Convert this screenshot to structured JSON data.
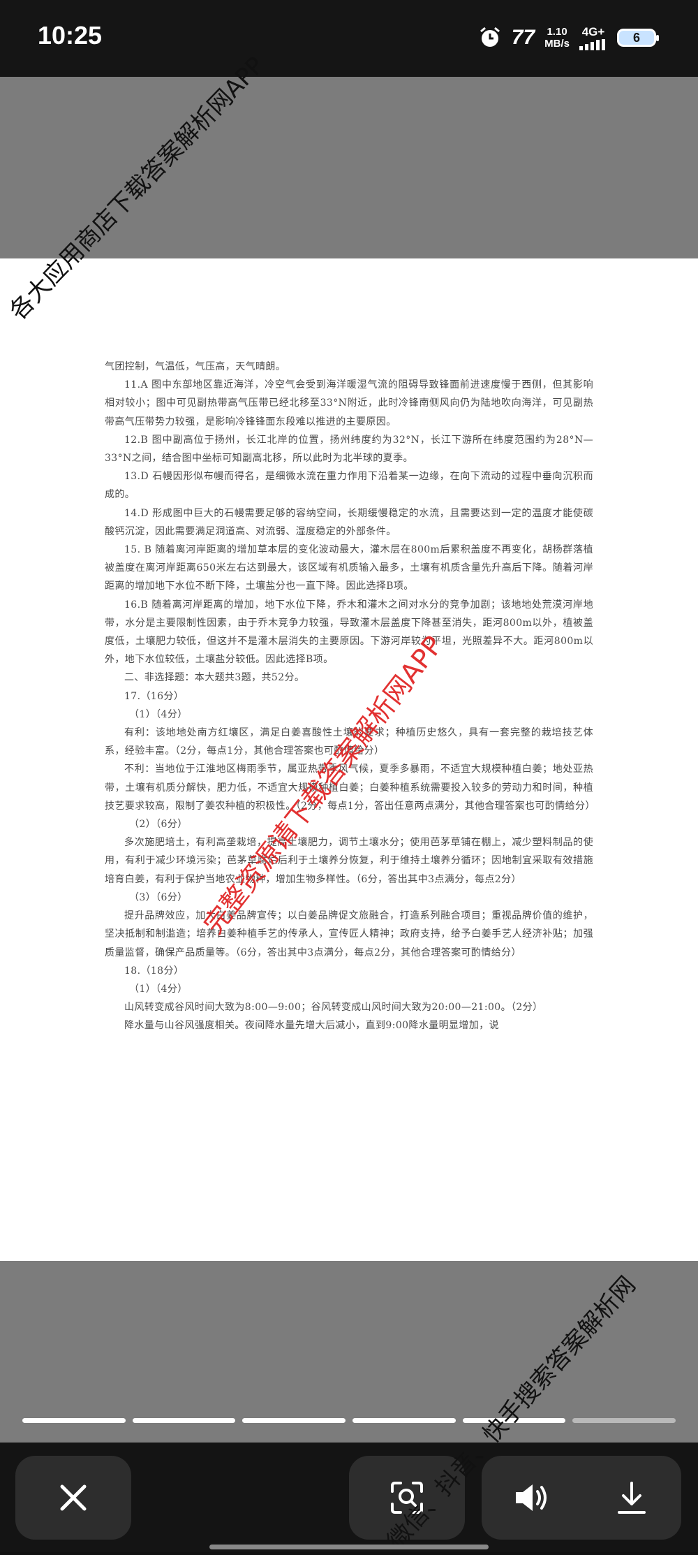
{
  "status_bar": {
    "time": "10:25",
    "carrier_logo": "77",
    "speed_value": "1.10",
    "speed_unit": "MB/s",
    "network_type": "4G+",
    "battery_level": "6"
  },
  "document": {
    "lines": [
      "气团控制，气温低，气压高，天气晴朗。",
      "11.A 图中东部地区靠近海洋，冷空气会受到海洋暖湿气流的阻碍导致锋面前进速度慢于西侧，但其影响相对较小；图中可见副热带高气压带已经北移至33°N附近，此时冷锋南侧风向仍为陆地吹向海洋，可见副热带高气压带势力较强，是影响冷锋锋面东段难以推进的主要原因。",
      "12.B 图中副高位于扬州，长江北岸的位置，扬州纬度约为32°N，长江下游所在纬度范围约为28°N—33°N之间，结合图中坐标可知副高北移，所以此时为北半球的夏季。",
      "13.D 石幔因形似布幔而得名，是细微水流在重力作用下沿着某一边缘，在向下流动的过程中垂向沉积而成的。",
      "14.D 形成图中巨大的石幔需要足够的容纳空间，长期缓慢稳定的水流，且需要达到一定的温度才能使碳酸钙沉淀，因此需要满足洞道高、对流弱、湿度稳定的外部条件。",
      "15. B 随着离河岸距离的增加草本层的变化波动最大，灌木层在800m后累积盖度不再变化，胡杨群落植被盖度在离河岸距离650米左右达到最大，该区域有机质输入最多，土壤有机质含量先升高后下降。随着河岸距离的增加地下水位不断下降，土壤盐分也一直下降。因此选择B项。",
      "16.B 随着离河岸距离的增加，地下水位下降，乔木和灌木之间对水分的竞争加剧；该地地处荒漠河岸地带，水分是主要限制性因素，由于乔木竞争力较强，导致灌木层盖度下降甚至消失，距河800m以外，植被盖度低，土壤肥力较低，但这并不是灌木层消失的主要原因。下游河岸较为平坦，光照差异不大。距河800m以外，地下水位较低，土壤盐分较低。因此选择B项。",
      "二、非选择题：本大题共3题，共52分。",
      "17.（16分）",
      "（1）（4分）",
      "有利：该地地处南方红壤区，满足白姜喜酸性土壤的要求；种植历史悠久，具有一套完整的栽培技艺体系，经验丰富。（2分，每点1分，其他合理答案也可酌情给分）",
      "不利：当地位于江淮地区梅雨季节，属亚热带季风气候，夏季多暴雨，不适宜大规模种植白姜；地处亚热带，土壤有机质分解快，肥力低，不适宜大规模种植白姜；白姜种植系统需要投入较多的劳动力和时间，种植技艺要求较高，限制了姜农种植的积极性。（2分，每点1分，答出任意两点满分，其他合理答案也可酌情给分）",
      "（2）（6分）",
      "多次施肥培土，有利高垄栽培，提高土壤肥力，调节土壤水分；使用芭茅草铺在棚上，减少塑料制品的使用，有利于减少环境污染；芭茅草腐烂后利于土壤养分恢复，利于维持土壤养分循环；因地制宜采取有效措施培育白姜，有利于保护当地农业物种，增加生物多样性。（6分，答出其中3点满分，每点2分）",
      "（3）（6分）",
      "提升品牌效应，加大白姜品牌宣传；以白姜品牌促文旅融合，打造系列融合项目；重视品牌价值的维护，坚决抵制和制滥造；培养白姜种植手艺的传承人，宣传匠人精神；政府支持，给予白姜手艺人经济补贴；加强质量监督，确保产品质量等。（6分，答出其中3点满分，每点2分，其他合理答案可酌情给分）",
      "18.（18分）",
      "（1）（4分）",
      "山风转变成谷风时间大致为8:00—9:00；谷风转变成山风时间大致为20:00—21:00。（2分）",
      "降水量与山谷风强度相关。夜间降水量先增大后减小，直到9:00降水量明显增加，说"
    ]
  },
  "watermarks": {
    "top": "各大应用商店下载答案解析网APP",
    "center": "完整资源请下载答案解析网APP",
    "bottom": "微信、抖音、快手搜索答案解析网"
  },
  "progress": {
    "total_pages": 6,
    "current_page": 5
  },
  "bottom_bar": {
    "close_icon": "close-icon",
    "scan_icon": "scan-icon",
    "volume_icon": "volume-icon",
    "download_icon": "download-icon"
  },
  "colors": {
    "watermark_red": "#e02020",
    "viewer_gray": "#7c7c7c",
    "bar_dark": "#141414",
    "button_bg": "#2d2d2d"
  }
}
